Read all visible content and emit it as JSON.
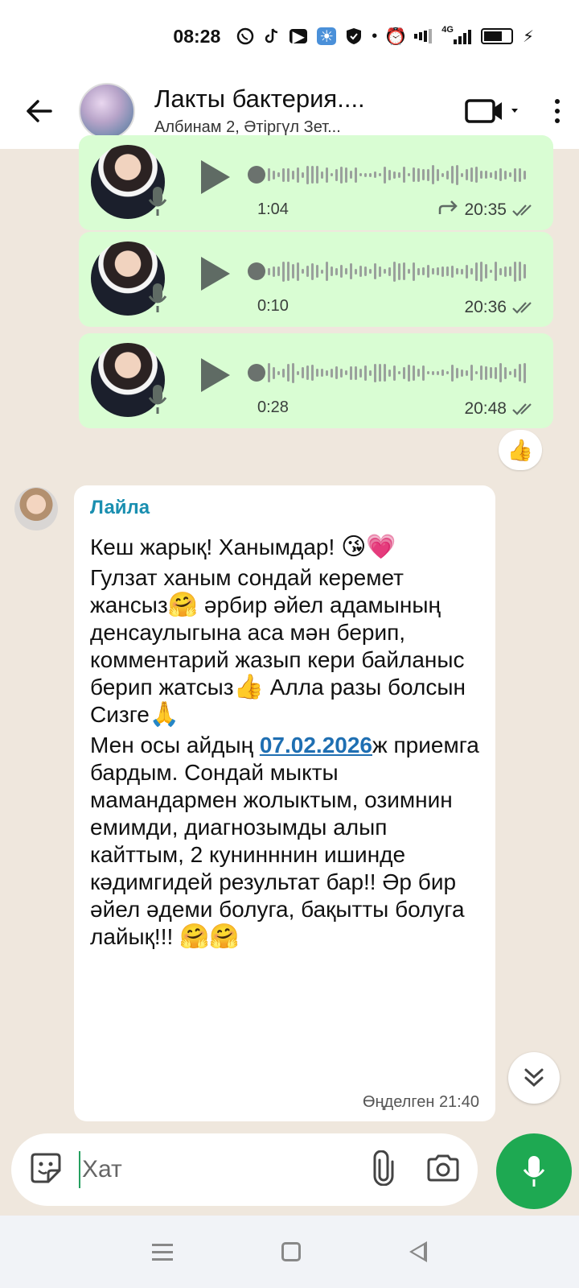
{
  "status_bar": {
    "time": "08:28",
    "network": "4G",
    "icons": [
      "whatsapp-icon",
      "tiktok-icon",
      "youtube-icon",
      "weather-icon",
      "shield-icon",
      "dot-icon",
      "alarm-icon",
      "signal-icon",
      "signal-4g-icon",
      "battery-icon",
      "charging-icon"
    ]
  },
  "header": {
    "title": "Лакты бактерия....",
    "subtitle": "Албинам 2, Әтіргүл Зет..."
  },
  "voice_messages": [
    {
      "duration": "1:04",
      "time": "20:35",
      "forwarded": true
    },
    {
      "duration": "0:10",
      "time": "20:36",
      "forwarded": false
    },
    {
      "duration": "0:28",
      "time": "20:48",
      "forwarded": false
    }
  ],
  "reaction": {
    "emoji": "👍"
  },
  "incoming_message": {
    "sender": "Лайла",
    "line1": "Кеш жарық! Ханымдар! ",
    "line1_emoji": "😘💗",
    "line2": "Гулзат ханым сондай керемет жансыз",
    "line2_emoji": "🤗",
    "line3": " әрбир әйел адамының денсаулыгына аса мән берип, комментарий жазып кери байланыс берип жатсыз",
    "line3_emoji": "👍",
    "line4": " Алла разы болсын Сизге",
    "line4_emoji": "🙏",
    "line5_pre": "Мен осы айдың ",
    "line5_date": "07.02.2026",
    "line5_post": "ж приемга бардым. Сондай мыкты мамандармен жолыктым, озимнин емимди, диагнозымды алып кайттым, 2 кунинннин ишинде кәдимгидей результат бар!! Әр бир әйел әдеми болуга, бақытты болуга лайық!!! ",
    "line5_emoji": "🤗🤗",
    "edited_label": "Өңделген",
    "time": "21:40"
  },
  "input": {
    "placeholder": "Хат"
  },
  "colors": {
    "bubble_out": "#d9fdd3",
    "bubble_in": "#ffffff",
    "accent_green": "#1ea952",
    "sender_name": "#1a8fb0",
    "link": "#1f6fb2",
    "chat_background": "#efe7dd"
  }
}
